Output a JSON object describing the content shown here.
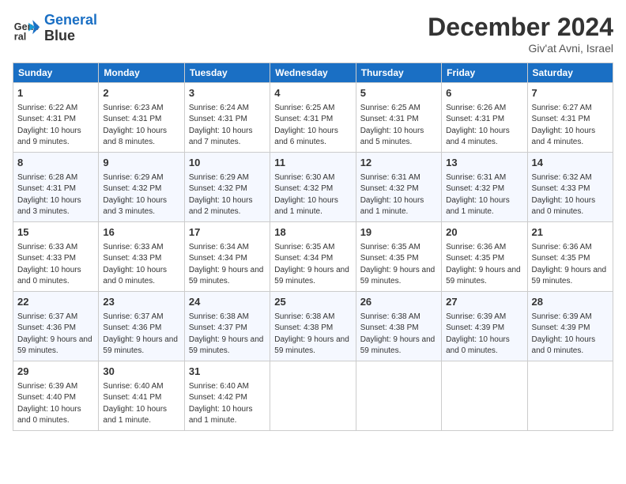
{
  "header": {
    "logo_line1": "General",
    "logo_line2": "Blue",
    "month": "December 2024",
    "location": "Giv'at Avni, Israel"
  },
  "weekdays": [
    "Sunday",
    "Monday",
    "Tuesday",
    "Wednesday",
    "Thursday",
    "Friday",
    "Saturday"
  ],
  "weeks": [
    [
      {
        "day": "1",
        "sunrise": "6:22 AM",
        "sunset": "4:31 PM",
        "daylight": "10 hours and 9 minutes."
      },
      {
        "day": "2",
        "sunrise": "6:23 AM",
        "sunset": "4:31 PM",
        "daylight": "10 hours and 8 minutes."
      },
      {
        "day": "3",
        "sunrise": "6:24 AM",
        "sunset": "4:31 PM",
        "daylight": "10 hours and 7 minutes."
      },
      {
        "day": "4",
        "sunrise": "6:25 AM",
        "sunset": "4:31 PM",
        "daylight": "10 hours and 6 minutes."
      },
      {
        "day": "5",
        "sunrise": "6:25 AM",
        "sunset": "4:31 PM",
        "daylight": "10 hours and 5 minutes."
      },
      {
        "day": "6",
        "sunrise": "6:26 AM",
        "sunset": "4:31 PM",
        "daylight": "10 hours and 4 minutes."
      },
      {
        "day": "7",
        "sunrise": "6:27 AM",
        "sunset": "4:31 PM",
        "daylight": "10 hours and 4 minutes."
      }
    ],
    [
      {
        "day": "8",
        "sunrise": "6:28 AM",
        "sunset": "4:31 PM",
        "daylight": "10 hours and 3 minutes."
      },
      {
        "day": "9",
        "sunrise": "6:29 AM",
        "sunset": "4:32 PM",
        "daylight": "10 hours and 3 minutes."
      },
      {
        "day": "10",
        "sunrise": "6:29 AM",
        "sunset": "4:32 PM",
        "daylight": "10 hours and 2 minutes."
      },
      {
        "day": "11",
        "sunrise": "6:30 AM",
        "sunset": "4:32 PM",
        "daylight": "10 hours and 1 minute."
      },
      {
        "day": "12",
        "sunrise": "6:31 AM",
        "sunset": "4:32 PM",
        "daylight": "10 hours and 1 minute."
      },
      {
        "day": "13",
        "sunrise": "6:31 AM",
        "sunset": "4:32 PM",
        "daylight": "10 hours and 1 minute."
      },
      {
        "day": "14",
        "sunrise": "6:32 AM",
        "sunset": "4:33 PM",
        "daylight": "10 hours and 0 minutes."
      }
    ],
    [
      {
        "day": "15",
        "sunrise": "6:33 AM",
        "sunset": "4:33 PM",
        "daylight": "10 hours and 0 minutes."
      },
      {
        "day": "16",
        "sunrise": "6:33 AM",
        "sunset": "4:33 PM",
        "daylight": "10 hours and 0 minutes."
      },
      {
        "day": "17",
        "sunrise": "6:34 AM",
        "sunset": "4:34 PM",
        "daylight": "9 hours and 59 minutes."
      },
      {
        "day": "18",
        "sunrise": "6:35 AM",
        "sunset": "4:34 PM",
        "daylight": "9 hours and 59 minutes."
      },
      {
        "day": "19",
        "sunrise": "6:35 AM",
        "sunset": "4:35 PM",
        "daylight": "9 hours and 59 minutes."
      },
      {
        "day": "20",
        "sunrise": "6:36 AM",
        "sunset": "4:35 PM",
        "daylight": "9 hours and 59 minutes."
      },
      {
        "day": "21",
        "sunrise": "6:36 AM",
        "sunset": "4:35 PM",
        "daylight": "9 hours and 59 minutes."
      }
    ],
    [
      {
        "day": "22",
        "sunrise": "6:37 AM",
        "sunset": "4:36 PM",
        "daylight": "9 hours and 59 minutes."
      },
      {
        "day": "23",
        "sunrise": "6:37 AM",
        "sunset": "4:36 PM",
        "daylight": "9 hours and 59 minutes."
      },
      {
        "day": "24",
        "sunrise": "6:38 AM",
        "sunset": "4:37 PM",
        "daylight": "9 hours and 59 minutes."
      },
      {
        "day": "25",
        "sunrise": "6:38 AM",
        "sunset": "4:38 PM",
        "daylight": "9 hours and 59 minutes."
      },
      {
        "day": "26",
        "sunrise": "6:38 AM",
        "sunset": "4:38 PM",
        "daylight": "9 hours and 59 minutes."
      },
      {
        "day": "27",
        "sunrise": "6:39 AM",
        "sunset": "4:39 PM",
        "daylight": "10 hours and 0 minutes."
      },
      {
        "day": "28",
        "sunrise": "6:39 AM",
        "sunset": "4:39 PM",
        "daylight": "10 hours and 0 minutes."
      }
    ],
    [
      {
        "day": "29",
        "sunrise": "6:39 AM",
        "sunset": "4:40 PM",
        "daylight": "10 hours and 0 minutes."
      },
      {
        "day": "30",
        "sunrise": "6:40 AM",
        "sunset": "4:41 PM",
        "daylight": "10 hours and 1 minute."
      },
      {
        "day": "31",
        "sunrise": "6:40 AM",
        "sunset": "4:42 PM",
        "daylight": "10 hours and 1 minute."
      },
      null,
      null,
      null,
      null
    ]
  ]
}
